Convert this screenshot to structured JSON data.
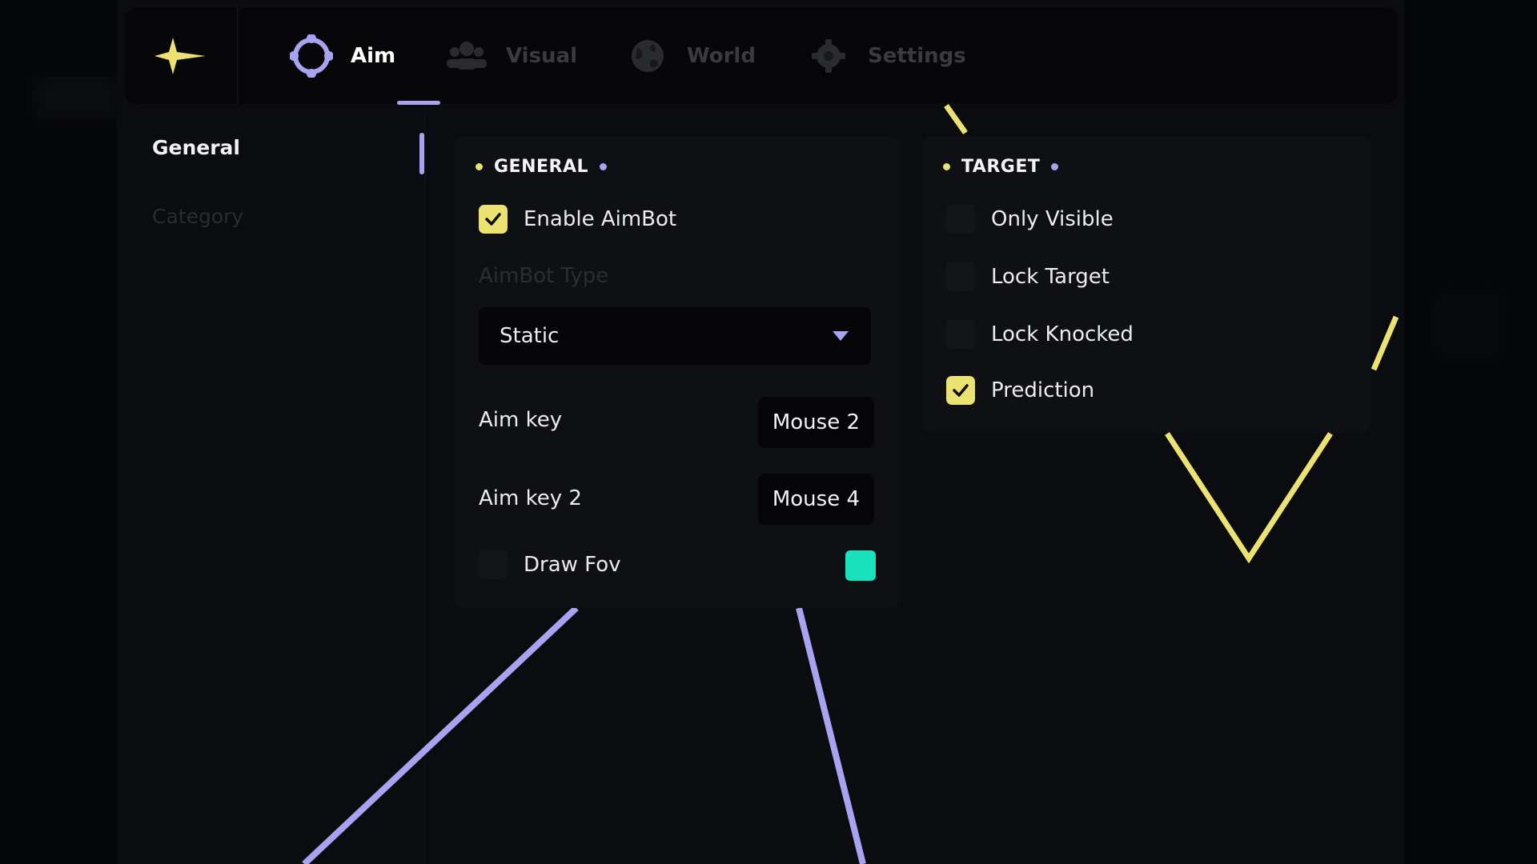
{
  "tabs": [
    {
      "label": "Aim",
      "icon": "crosshair-icon",
      "active": true
    },
    {
      "label": "Visual",
      "icon": "users-icon",
      "active": false
    },
    {
      "label": "World",
      "icon": "globe-icon",
      "active": false
    },
    {
      "label": "Settings",
      "icon": "gear-icon",
      "active": false
    }
  ],
  "sidebar": {
    "items": [
      {
        "label": "General",
        "active": true
      },
      {
        "label": "Category",
        "active": false
      }
    ]
  },
  "general_panel": {
    "title": "GENERAL",
    "enable_aimbot": {
      "label": "Enable AimBot",
      "checked": true
    },
    "aimbot_type_label": "AimBot Type",
    "aimbot_type_value": "Static",
    "aim_key": {
      "label": "Aim key",
      "value": "Mouse 2"
    },
    "aim_key_2": {
      "label": "Aim key 2",
      "value": "Mouse 4"
    },
    "draw_fov": {
      "label": "Draw Fov",
      "checked": false,
      "color": "#19e3bd"
    }
  },
  "target_panel": {
    "title": "TARGET",
    "options": [
      {
        "label": "Only Visible",
        "checked": false
      },
      {
        "label": "Lock Target",
        "checked": false
      },
      {
        "label": "Lock Knocked",
        "checked": false
      },
      {
        "label": "Prediction",
        "checked": true
      }
    ]
  },
  "colors": {
    "accent_yellow": "#ebe271",
    "accent_purple": "#a8a3f0",
    "fov_color": "#19e3bd"
  }
}
